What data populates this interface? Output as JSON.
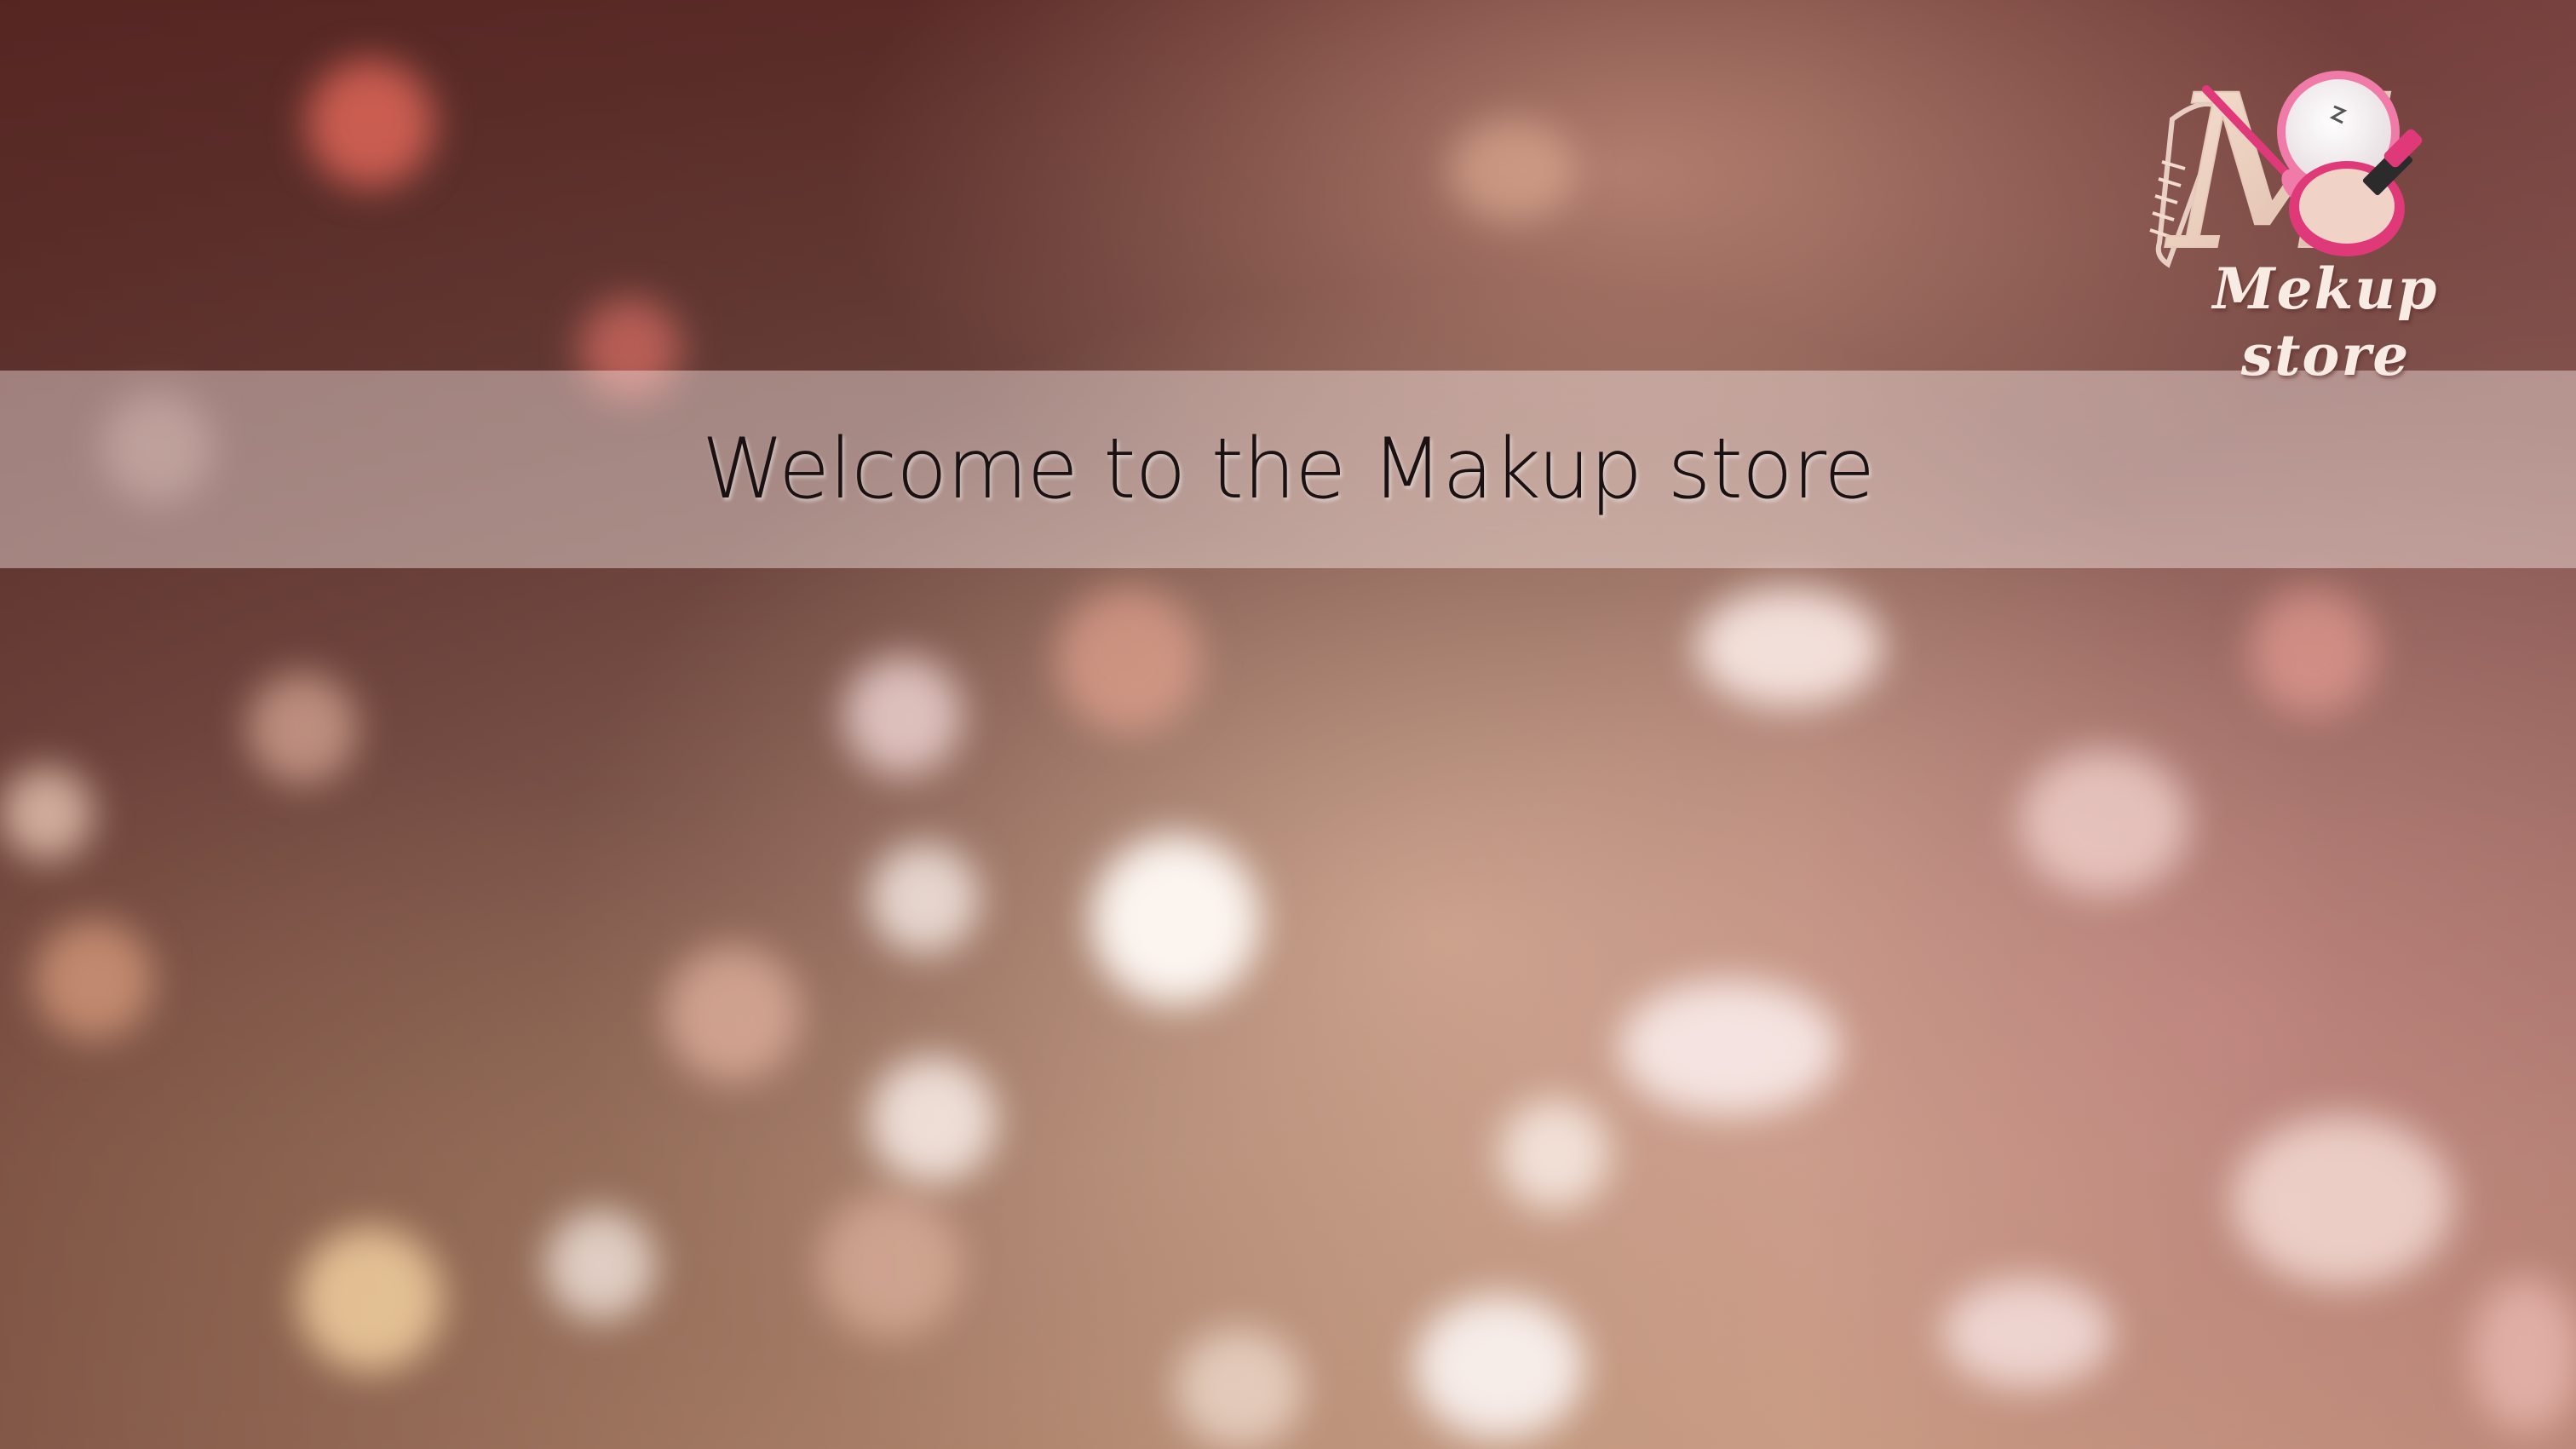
{
  "slide": {
    "welcome_text": "Welcome to the Makup store"
  },
  "logo": {
    "monogram": "M",
    "brand_text": "Mekup store",
    "icons": [
      "comb-icon",
      "makeup-brush-icon",
      "compact-mirror-icon",
      "lipstick-icon"
    ]
  },
  "colors": {
    "accent": "#e0397a",
    "band": "#f3dcd8",
    "text": "#1a1212"
  }
}
